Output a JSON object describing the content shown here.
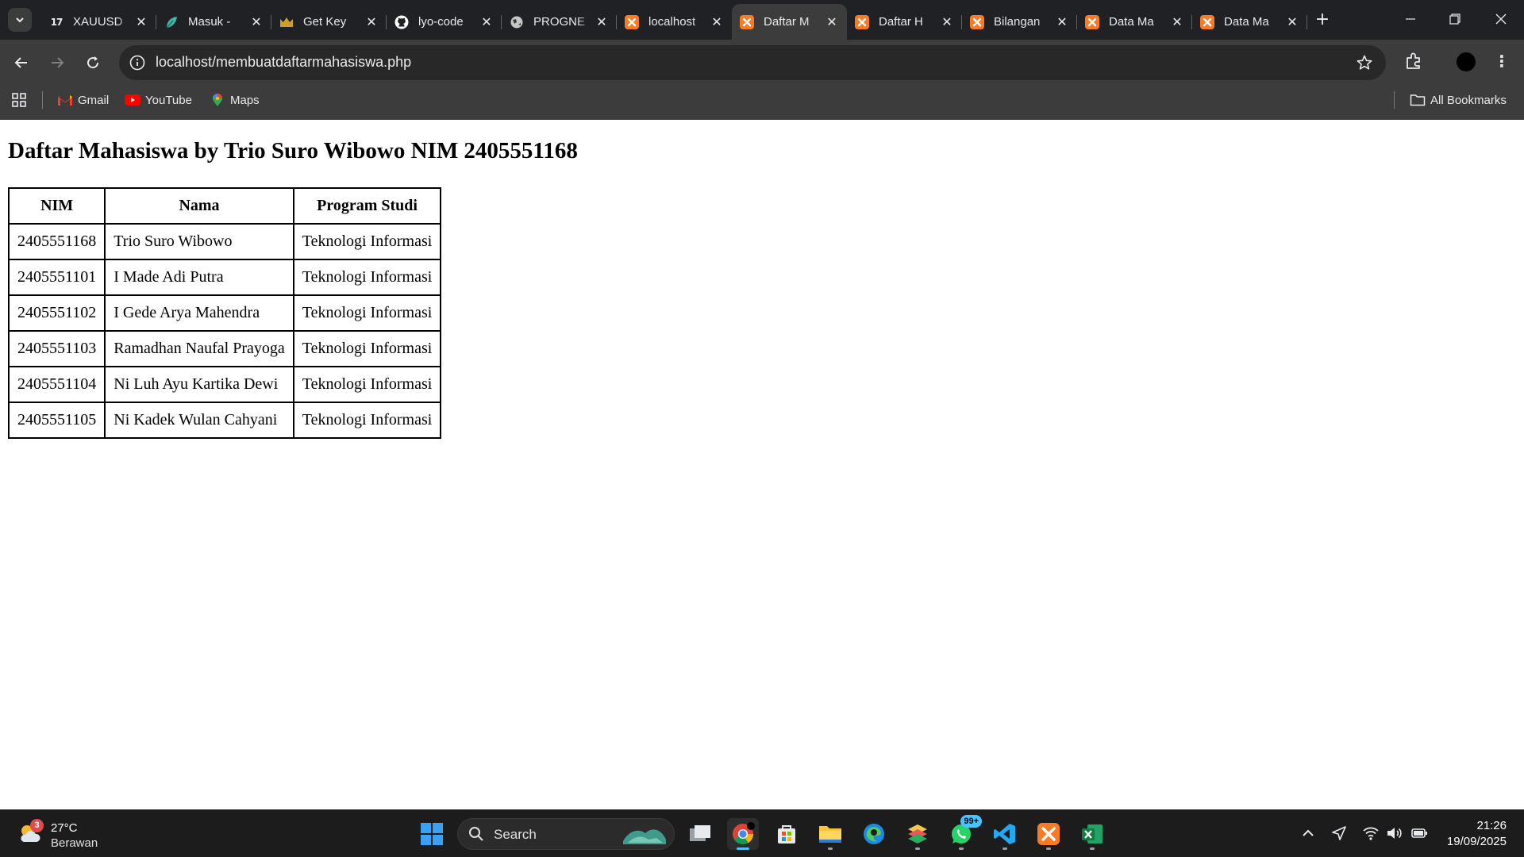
{
  "browser": {
    "tabs": [
      {
        "title": "XAUUSD",
        "favicon": "tradingview-icon",
        "active": false
      },
      {
        "title": "Masuk - ",
        "favicon": "leaf-icon",
        "active": false
      },
      {
        "title": "Get Key",
        "favicon": "key-icon",
        "active": false
      },
      {
        "title": "lyo-code",
        "favicon": "github-icon",
        "active": false
      },
      {
        "title": "PROGNE",
        "favicon": "globe-icon",
        "active": false
      },
      {
        "title": "localhost",
        "favicon": "xampp-icon",
        "active": false
      },
      {
        "title": "Daftar M",
        "favicon": "xampp-icon",
        "active": true
      },
      {
        "title": "Daftar H",
        "favicon": "xampp-icon",
        "active": false
      },
      {
        "title": "Bilangan",
        "favicon": "xampp-icon",
        "active": false
      },
      {
        "title": "Data Ma",
        "favicon": "xampp-icon",
        "active": false
      },
      {
        "title": "Data Ma",
        "favicon": "xampp-icon",
        "active": false
      }
    ],
    "url": "localhost/membuatdaftarmahasiswa.php",
    "bookmarks": [
      {
        "label": "Gmail",
        "icon": "gmail-icon"
      },
      {
        "label": "YouTube",
        "icon": "youtube-icon"
      },
      {
        "label": "Maps",
        "icon": "maps-icon"
      }
    ],
    "all_bookmarks_label": "All Bookmarks"
  },
  "page": {
    "heading": "Daftar Mahasiswa by Trio Suro Wibowo NIM 2405551168",
    "table": {
      "headers": [
        "NIM",
        "Nama",
        "Program Studi"
      ],
      "rows": [
        [
          "2405551168",
          "Trio Suro Wibowo",
          "Teknologi Informasi"
        ],
        [
          "2405551101",
          "I Made Adi Putra",
          "Teknologi Informasi"
        ],
        [
          "2405551102",
          "I Gede Arya Mahendra",
          "Teknologi Informasi"
        ],
        [
          "2405551103",
          "Ramadhan Naufal Prayoga",
          "Teknologi Informasi"
        ],
        [
          "2405551104",
          "Ni Luh Ayu Kartika Dewi",
          "Teknologi Informasi"
        ],
        [
          "2405551105",
          "Ni Kadek Wulan Cahyani",
          "Teknologi Informasi"
        ]
      ]
    }
  },
  "taskbar": {
    "weather": {
      "temp": "27°C",
      "condition": "Berawan",
      "badge": "3"
    },
    "search_label": "Search",
    "whatsapp_badge": "99+",
    "time": "21:26",
    "date": "19/09/2025"
  },
  "colors": {
    "chrome_dark": "#202124",
    "chrome_toolbar": "#3c3c3c",
    "xampp_orange": "#fb7a24",
    "taskbar": "#1c1c1c"
  }
}
